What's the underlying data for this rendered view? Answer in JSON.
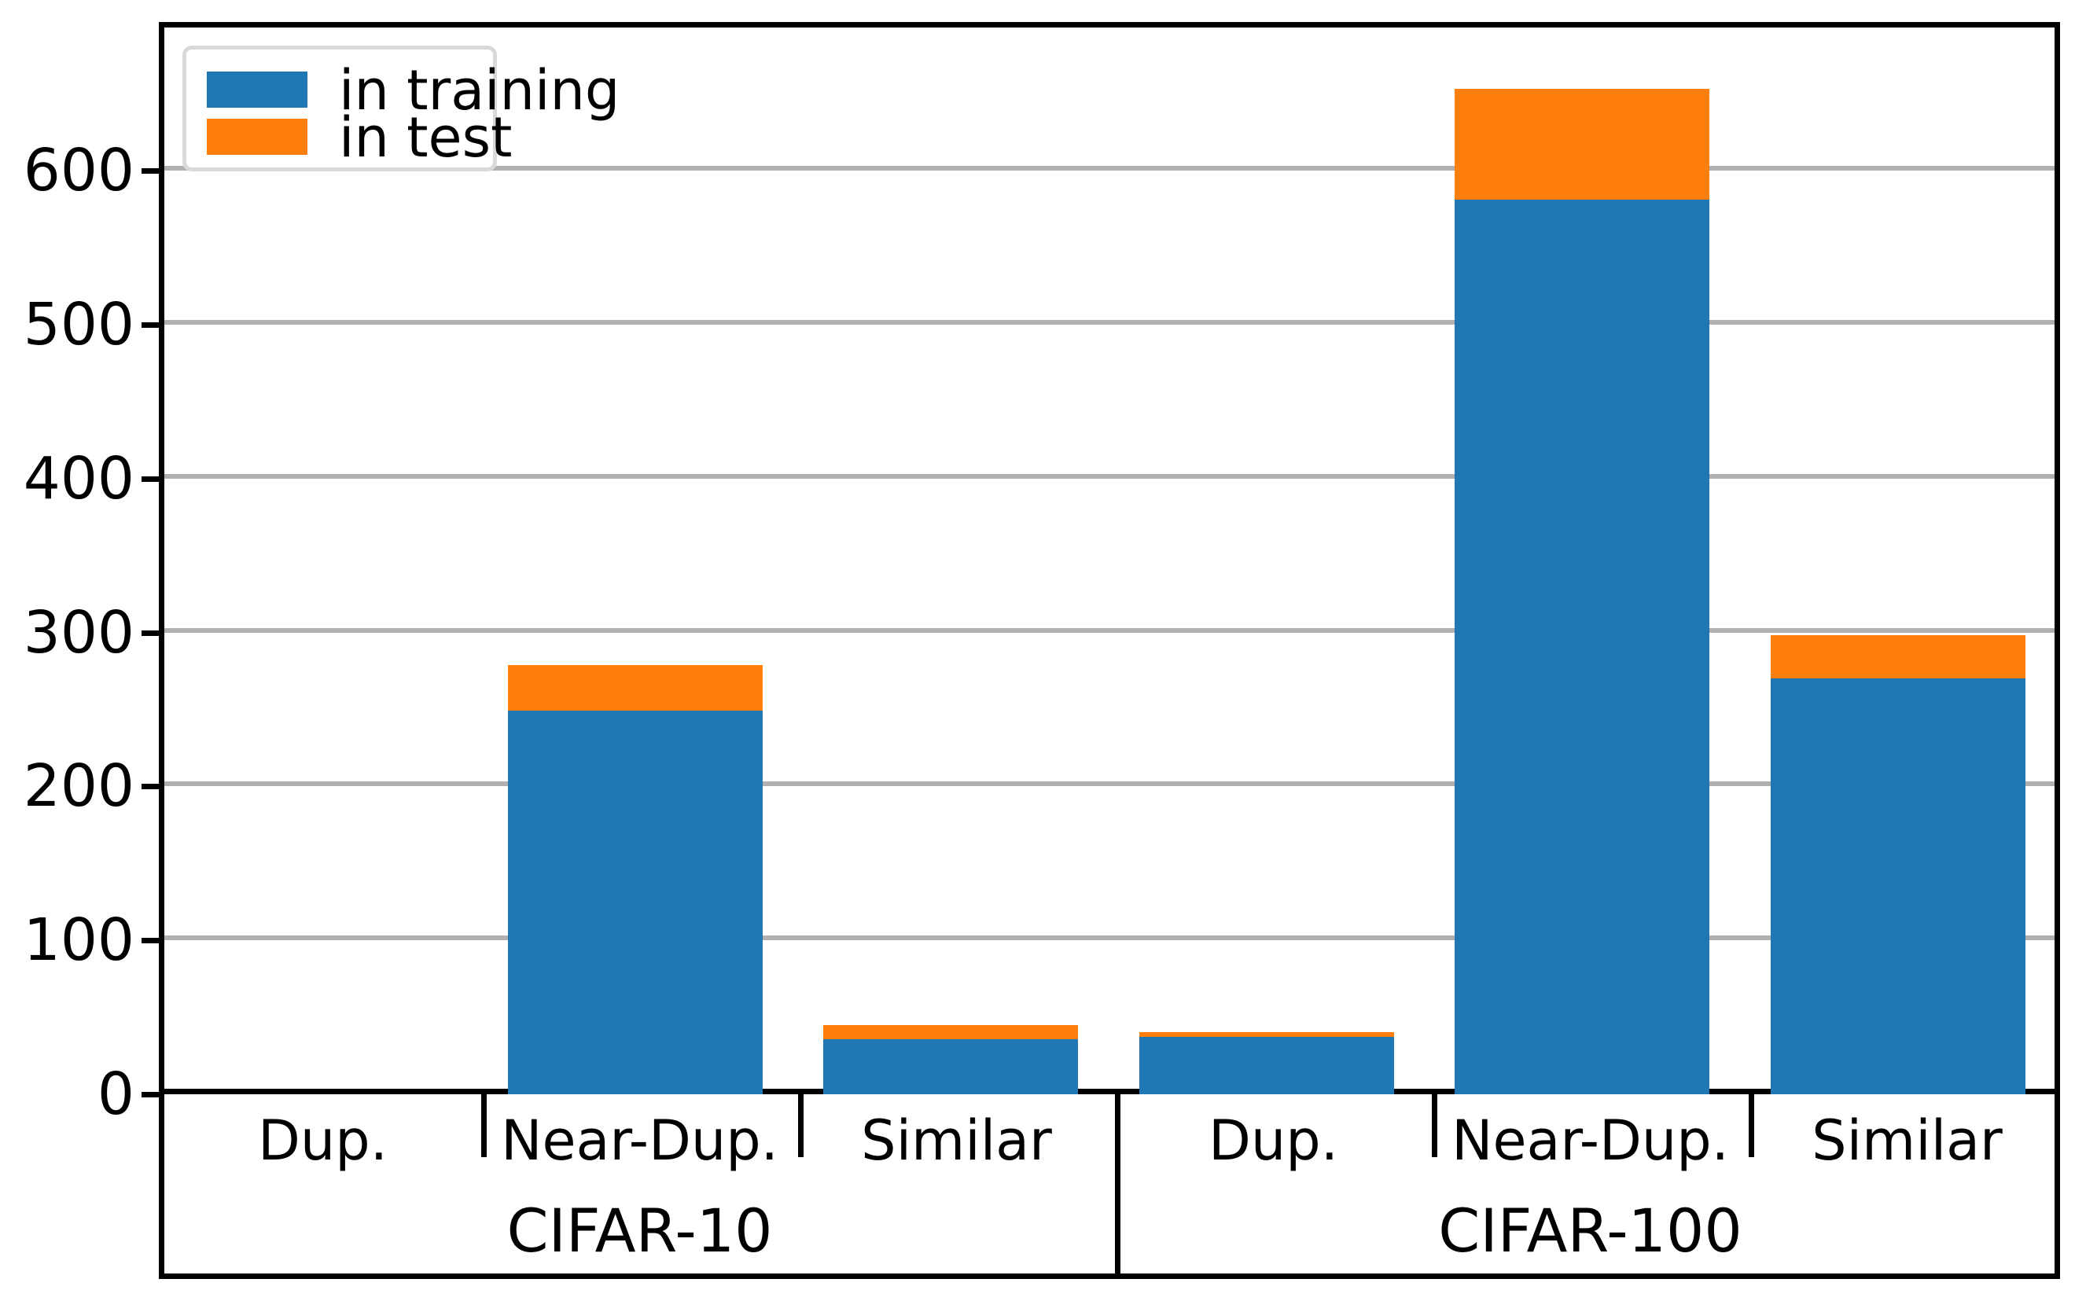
{
  "legend": {
    "entries": [
      {
        "label": "in training",
        "color": "#1f77b4",
        "icon": "square-swatch-icon"
      },
      {
        "label": "in test",
        "color": "#ff7f0e",
        "icon": "square-swatch-icon"
      }
    ]
  },
  "yaxis": {
    "ticks": [
      "0",
      "100",
      "200",
      "300",
      "400",
      "500",
      "600"
    ]
  },
  "xaxis": {
    "groups": [
      "Dup.",
      "Near-Dup.",
      "Similar",
      "Dup.",
      "Near-Dup.",
      "Similar"
    ],
    "datasets": [
      "CIFAR-10",
      "CIFAR-100"
    ]
  },
  "chart_data": {
    "type": "bar",
    "title": "",
    "xlabel": "",
    "ylabel": "",
    "stacked": true,
    "grid": true,
    "legend_position": "upper left",
    "ylim": [
      0,
      695
    ],
    "yticks": [
      0,
      100,
      200,
      300,
      400,
      500,
      600
    ],
    "categories": [
      "CIFAR-10 / Dup.",
      "CIFAR-10 / Near-Dup.",
      "CIFAR-10 / Similar",
      "CIFAR-100 / Dup.",
      "CIFAR-100 / Near-Dup.",
      "CIFAR-100 / Similar"
    ],
    "series": [
      {
        "name": "in training",
        "color": "#1f77b4",
        "values": [
          0,
          249,
          36,
          37,
          581,
          270
        ]
      },
      {
        "name": "in test",
        "color": "#ff7f0e",
        "values": [
          0,
          30,
          9,
          3,
          72,
          28
        ]
      }
    ],
    "totals": [
      0,
      279,
      45,
      40,
      653,
      298
    ],
    "group_axis": {
      "level1": [
        "Dup.",
        "Near-Dup.",
        "Similar",
        "Dup.",
        "Near-Dup.",
        "Similar"
      ],
      "level2": [
        "CIFAR-10",
        "CIFAR-100"
      ]
    }
  }
}
